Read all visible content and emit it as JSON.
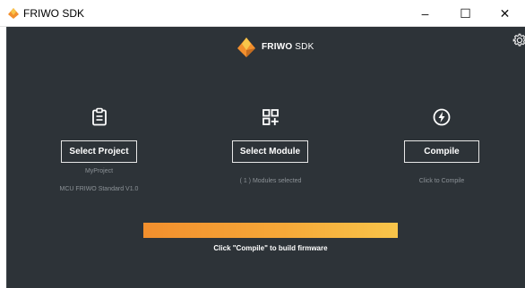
{
  "window": {
    "title": "FRIWO SDK",
    "controls": {
      "minimize": "–",
      "maximize": "☐",
      "close": "✕"
    }
  },
  "brand": {
    "name_bold": "FRIWO",
    "name_light": " SDK"
  },
  "settings_icon": "gear-icon",
  "project": {
    "icon": "clipboard-icon",
    "button_label": "Select Project",
    "name": "MyProject",
    "mcu": "MCU FRIWO Standard V1.0"
  },
  "module": {
    "icon": "grid-plus-icon",
    "button_label": "Select Module",
    "status": "( 1 )  Modules selected"
  },
  "compile": {
    "icon": "lightning-circle-icon",
    "button_label": "Compile",
    "hint": "Click to Compile"
  },
  "progress": {
    "value_percent": 100
  },
  "status_text": "Click \"Compile\" to build firmware",
  "colors": {
    "app_background": "#2d3338",
    "accent_orange": "#f28f2d",
    "accent_yellow": "#f8c54a",
    "button_border": "#e8e8e8",
    "muted_text": "#8c9297"
  }
}
